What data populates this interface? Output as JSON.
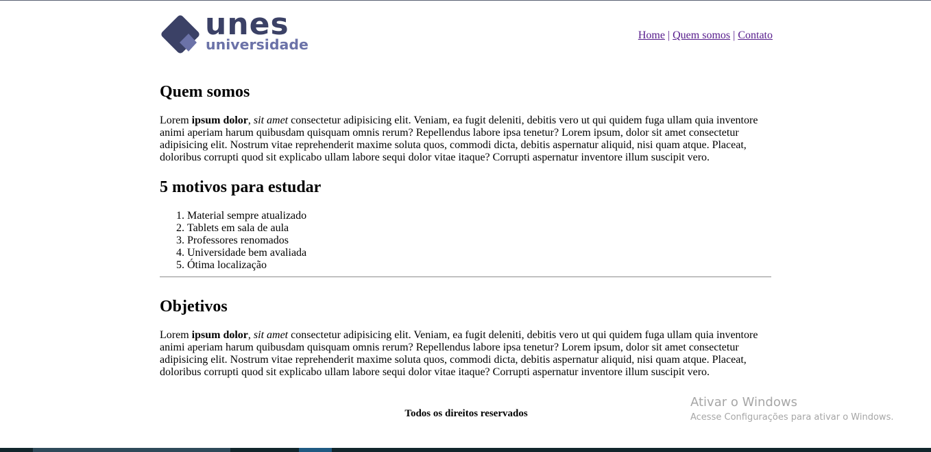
{
  "logo": {
    "word_top": "unes",
    "word_bottom": "universidade"
  },
  "nav": {
    "items": [
      "Home",
      "Quem somos",
      "Contato"
    ],
    "separator": "|"
  },
  "section_quem_somos": {
    "title": "Quem somos",
    "text_start": "Lorem ",
    "text_bold": "ipsum dolor",
    "text_comma": ", ",
    "text_italic": "sit amet",
    "text_rest": " consectetur adipisicing elit. Veniam, ea fugit deleniti, debitis vero ut qui quidem fuga ullam quia inventore animi aperiam harum quibusdam quisquam omnis rerum? Repellendus labore ipsa tenetur? Lorem ipsum, dolor sit amet consectetur adipisicing elit. Nostrum vitae reprehenderit maxime soluta quos, commodi dicta, debitis aspernatur aliquid, nisi quam atque. Placeat, doloribus corrupti quod sit explicabo ullam labore sequi dolor vitae itaque? Corrupti aspernatur inventore illum suscipit vero."
  },
  "section_motivos": {
    "title": "5 motivos para estudar",
    "items": [
      "Material sempre atualizado",
      "Tablets em sala de aula",
      "Professores renomados",
      "Universidade bem avaliada",
      "Ótima localização"
    ]
  },
  "section_objetivos": {
    "title": "Objetivos",
    "text_start": "Lorem ",
    "text_bold": "ipsum dolor",
    "text_comma": ", ",
    "text_italic": "sit amet",
    "text_rest": " consectetur adipisicing elit. Veniam, ea fugit deleniti, debitis vero ut qui quidem fuga ullam quia inventore animi aperiam harum quibusdam quisquam omnis rerum? Repellendus labore ipsa tenetur? Lorem ipsum, dolor sit amet consectetur adipisicing elit. Nostrum vitae reprehenderit maxime soluta quos, commodi dicta, debitis aspernatur aliquid, nisi quam atque. Placeat, doloribus corrupti quod sit explicabo ullam labore sequi dolor vitae itaque? Corrupti aspernatur inventore illum suscipit vero."
  },
  "footer": {
    "text": "Todos os direitos reservados"
  },
  "watermark": {
    "title": "Ativar o Windows",
    "subtitle": "Acesse Configurações para ativar o Windows."
  },
  "colors": {
    "logo_dark": "#3b4166",
    "logo_light": "#6b72a8",
    "link": "#551a8b"
  }
}
